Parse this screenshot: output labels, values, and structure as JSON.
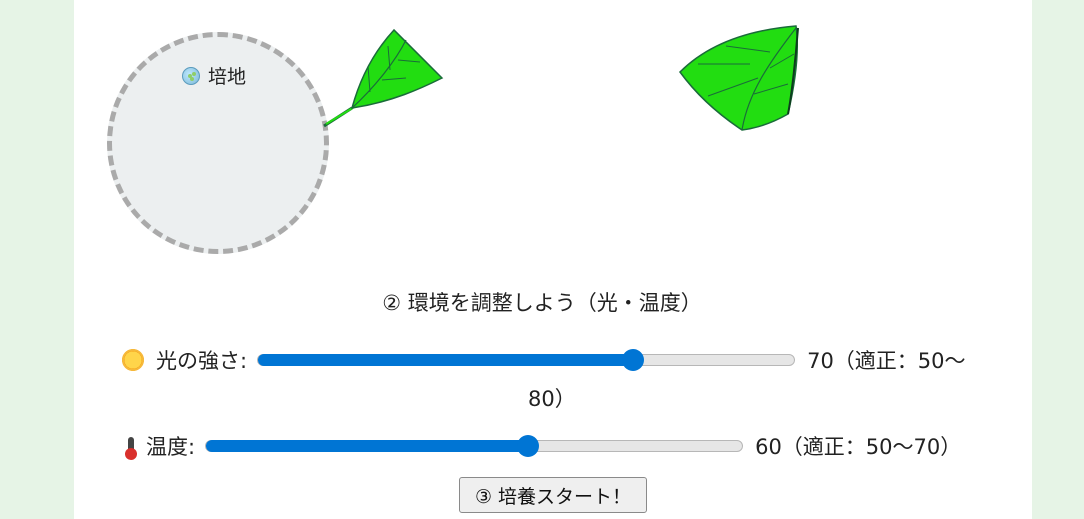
{
  "dish": {
    "label": "培地",
    "icon": "petri-dish-icon"
  },
  "step2": {
    "title": "② 環境を調整しよう（光・温度）"
  },
  "light": {
    "icon": "sun-icon",
    "label": "光の強さ:",
    "value": 70,
    "min": 0,
    "max": 100,
    "value_text_line1": "70（適正：50〜",
    "value_text_line2": "80）"
  },
  "temperature": {
    "icon": "thermometer-icon",
    "label": "温度:",
    "value": 60,
    "min": 0,
    "max": 100,
    "value_text": "60（適正：50〜70）"
  },
  "start_button": {
    "label": "③ 培養スタート！"
  },
  "colors": {
    "background": "#e6f4e6",
    "panel": "#ffffff",
    "accent": "#0075d4",
    "leaf": "#22dd11",
    "leaf_vein": "#1a6b3a"
  }
}
